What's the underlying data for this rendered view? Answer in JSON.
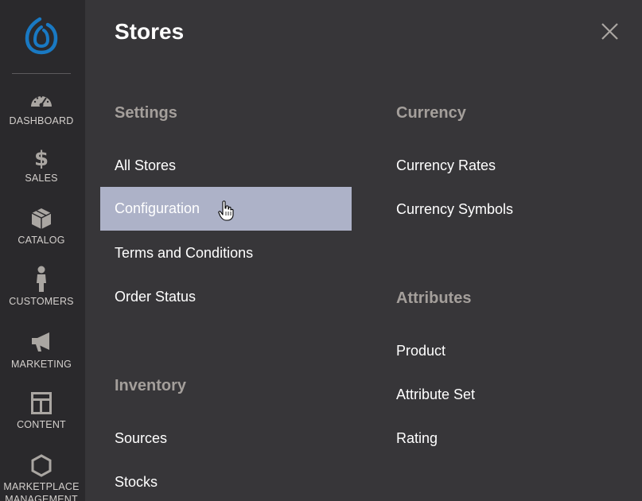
{
  "sidebar": {
    "items": [
      {
        "label": "DASHBOARD",
        "icon": "dashboard-gauge-icon"
      },
      {
        "label": "SALES",
        "icon": "dollar-icon"
      },
      {
        "label": "CATALOG",
        "icon": "box-icon"
      },
      {
        "label": "CUSTOMERS",
        "icon": "person-icon"
      },
      {
        "label": "MARKETING",
        "icon": "megaphone-icon"
      },
      {
        "label": "CONTENT",
        "icon": "layout-icon"
      },
      {
        "label": "MARKETPLACE",
        "label2": "MANAGEMENT",
        "icon": "hexagon-icon"
      }
    ]
  },
  "panel": {
    "title": "Stores",
    "sections": {
      "settings": {
        "heading": "Settings",
        "links": [
          "All Stores",
          "Configuration",
          "Terms and Conditions",
          "Order Status"
        ]
      },
      "inventory": {
        "heading": "Inventory",
        "links": [
          "Sources",
          "Stocks"
        ]
      },
      "currency": {
        "heading": "Currency",
        "links": [
          "Currency Rates",
          "Currency Symbols"
        ]
      },
      "attributes": {
        "heading": "Attributes",
        "links": [
          "Product",
          "Attribute Set",
          "Rating"
        ]
      }
    }
  },
  "colors": {
    "sidebar_bg": "#2a292c",
    "panel_bg": "#373639",
    "active_bg": "#adb2c8",
    "heading": "#a49f9b",
    "logo": "#1979c3"
  }
}
